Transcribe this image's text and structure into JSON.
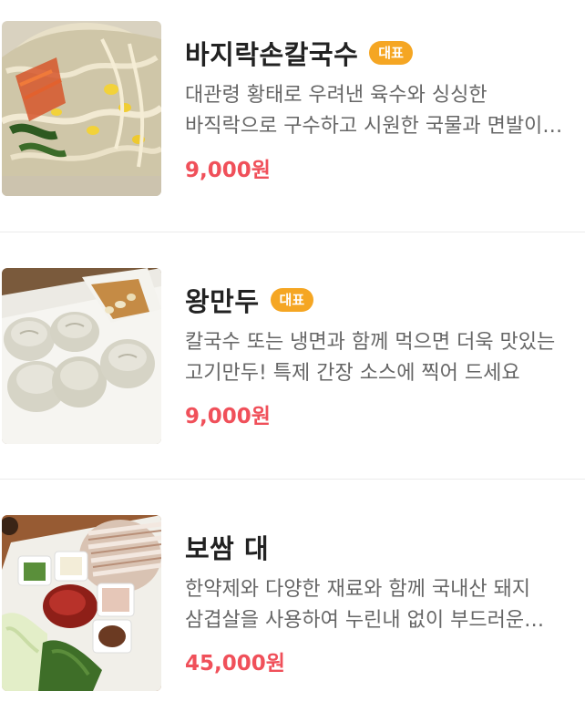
{
  "menu": {
    "items": [
      {
        "name": "바지락손칼국수",
        "badge": "대표",
        "description": "대관령 황태로 우려낸 육수와 싱싱한 바직락으로 구수하고 시원한 국물과 면발이 일품인 손칼국수",
        "price": "9,000원",
        "image": "bowl-of-noodles-with-bean-sprouts"
      },
      {
        "name": "왕만두",
        "badge": "대표",
        "description": "칼국수 또는 냉면과 함께 먹으면 더욱 맛있는 고기만두! 특제 간장 소스에 찍어 드세요",
        "price": "9,000원",
        "image": "plate-of-dumplings"
      },
      {
        "name": "보쌈 대",
        "badge": "",
        "description": "한약제와 다양한 재료와 함께 국내산 돼지 삼겹살을 사용하여 누린내 없이 부드러운 보쌈",
        "price": "45,000원",
        "image": "boiled-pork-platter"
      }
    ]
  },
  "colors": {
    "badge": "#f5a623",
    "price": "#f0505a",
    "title": "#222222",
    "description": "#666666",
    "divider": "#ebebeb"
  }
}
